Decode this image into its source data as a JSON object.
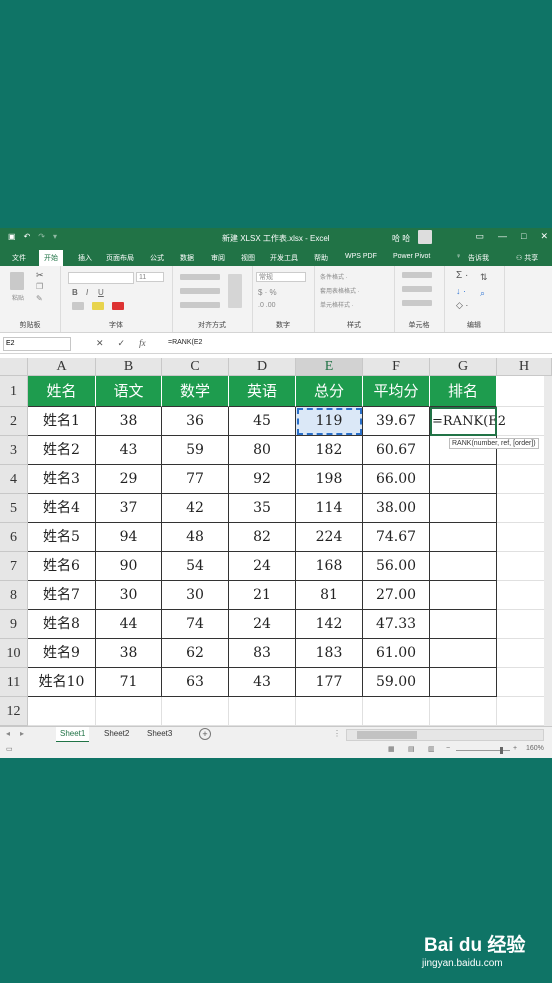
{
  "titlebar": {
    "title": "新建 XLSX 工作表.xlsx - Excel",
    "user": "哈 哈"
  },
  "menu": [
    "文件",
    "开始",
    "插入",
    "页面布局",
    "公式",
    "数据",
    "审阅",
    "视图",
    "开发工具",
    "帮助",
    "WPS PDF",
    "Power Pivot",
    "告诉我",
    "共享"
  ],
  "ribbon": {
    "groups": [
      "剪贴板",
      "字体",
      "对齐方式",
      "数字",
      "样式",
      "单元格",
      "编辑"
    ],
    "font_size": "11",
    "number_format": "常规",
    "style_items": [
      "条件格式 ·",
      "套用表格格式 ·",
      "单元格样式 ·"
    ],
    "paste": "粘贴"
  },
  "formula": {
    "namebox": "E2",
    "content": "=RANK(E2"
  },
  "columns": [
    "A",
    "B",
    "C",
    "D",
    "E",
    "F",
    "G",
    "H"
  ],
  "rows": [
    "1",
    "2",
    "3",
    "4",
    "5",
    "6",
    "7",
    "8",
    "9",
    "10",
    "11",
    "12"
  ],
  "table": {
    "headers": [
      "姓名",
      "语文",
      "数学",
      "英语",
      "总分",
      "平均分",
      "排名"
    ],
    "data": [
      [
        "姓名1",
        "38",
        "36",
        "45",
        "119",
        "39.67"
      ],
      [
        "姓名2",
        "43",
        "59",
        "80",
        "182",
        "60.67"
      ],
      [
        "姓名3",
        "29",
        "77",
        "92",
        "198",
        "66.00"
      ],
      [
        "姓名4",
        "37",
        "42",
        "35",
        "114",
        "38.00"
      ],
      [
        "姓名5",
        "94",
        "48",
        "82",
        "224",
        "74.67"
      ],
      [
        "姓名6",
        "90",
        "54",
        "24",
        "168",
        "56.00"
      ],
      [
        "姓名7",
        "30",
        "30",
        "21",
        "81",
        "27.00"
      ],
      [
        "姓名8",
        "44",
        "74",
        "24",
        "142",
        "47.33"
      ],
      [
        "姓名9",
        "38",
        "62",
        "83",
        "183",
        "61.00"
      ],
      [
        "姓名10",
        "71",
        "63",
        "43",
        "177",
        "59.00"
      ]
    ],
    "active_cell_text": "=RANK(E2"
  },
  "tooltip": "RANK(number, ref, [order])",
  "sheets": [
    "Sheet1",
    "Sheet2",
    "Sheet3"
  ],
  "zoom": "160%",
  "watermark": {
    "brand": "Bai du 经验",
    "url": "jingyan.baidu.com"
  }
}
